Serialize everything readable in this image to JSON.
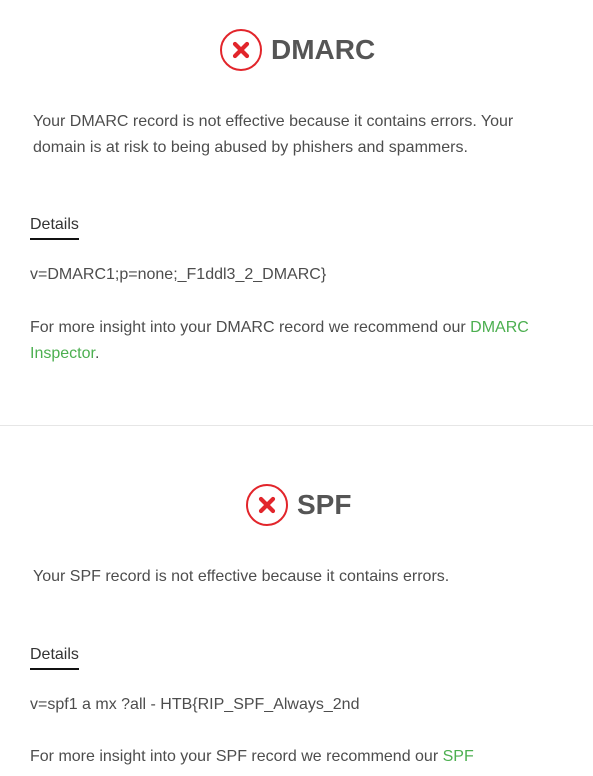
{
  "dmarc": {
    "title": "DMARC",
    "status_icon": "x-circle-icon",
    "description": "Your DMARC record is not effective because it contains errors. Your domain is at risk to being abused by phishers and spammers.",
    "details_label": "Details",
    "record": "v=DMARC1;p=none;_F1ddl3_2_DMARC}",
    "insight_prefix": "For more insight into your DMARC record we recommend our ",
    "insight_link": "DMARC Inspector",
    "insight_suffix": "."
  },
  "spf": {
    "title": "SPF",
    "status_icon": "x-circle-icon",
    "description": "Your SPF record is not effective because it contains errors.",
    "details_label": "Details",
    "record": "v=spf1 a mx ?all - HTB{RIP_SPF_Always_2nd",
    "insight_prefix": "For more insight into your SPF record we recommend our ",
    "insight_link": "SPF"
  },
  "colors": {
    "error_red": "#e2252b",
    "link_green": "#4caf50",
    "heading_gray": "#555555",
    "text_gray": "#4d4d4d",
    "divider": "#e6e6e6"
  }
}
